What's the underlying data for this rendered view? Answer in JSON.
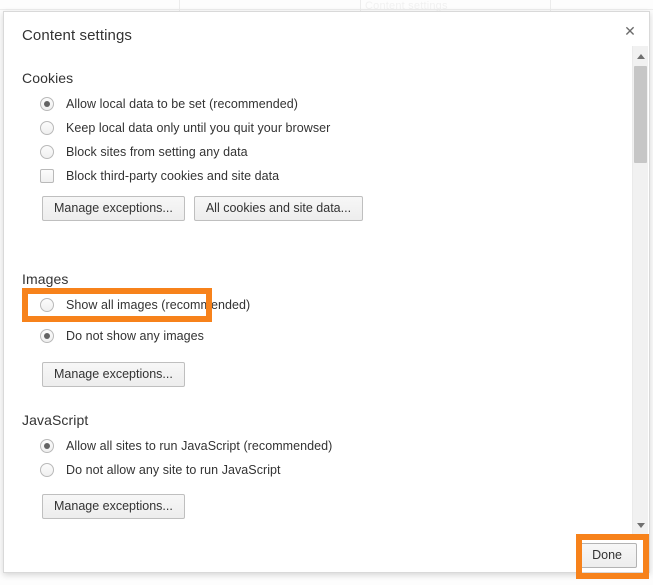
{
  "backdrop": {
    "ghost_text": "Content settings"
  },
  "dialog": {
    "title": "Content settings",
    "close_icon": "close-icon",
    "close_glyph": "✕"
  },
  "sections": [
    {
      "id": "cookies",
      "title": "Cookies",
      "options": [
        {
          "type": "radio",
          "label": "Allow local data to be set (recommended)",
          "checked": true
        },
        {
          "type": "radio",
          "label": "Keep local data only until you quit your browser",
          "checked": false
        },
        {
          "type": "radio",
          "label": "Block sites from setting any data",
          "checked": false
        },
        {
          "type": "checkbox",
          "label": "Block third-party cookies and site data",
          "checked": false
        }
      ],
      "buttons": [
        {
          "label": "Manage exceptions..."
        },
        {
          "label": "All cookies and site data..."
        }
      ]
    },
    {
      "id": "images",
      "title": "Images",
      "options": [
        {
          "type": "radio",
          "label": "Show all images (recommended)",
          "checked": false
        },
        {
          "type": "radio",
          "label": "Do not show any images",
          "checked": true,
          "highlighted": true
        }
      ],
      "buttons": [
        {
          "label": "Manage exceptions..."
        }
      ]
    },
    {
      "id": "javascript",
      "title": "JavaScript",
      "options": [
        {
          "type": "radio",
          "label": "Allow all sites to run JavaScript (recommended)",
          "checked": true
        },
        {
          "type": "radio",
          "label": "Do not allow any site to run JavaScript",
          "checked": false
        }
      ],
      "buttons": [
        {
          "label": "Manage exceptions..."
        }
      ]
    }
  ],
  "footer": {
    "done_label": "Done"
  },
  "scrollbar": {
    "up_arrow_icon": "chevron-up-icon",
    "down_arrow_icon": "chevron-down-icon"
  },
  "colors": {
    "highlight_orange": "#f7821b",
    "text": "#333333",
    "dialog_background": "#ffffff"
  }
}
